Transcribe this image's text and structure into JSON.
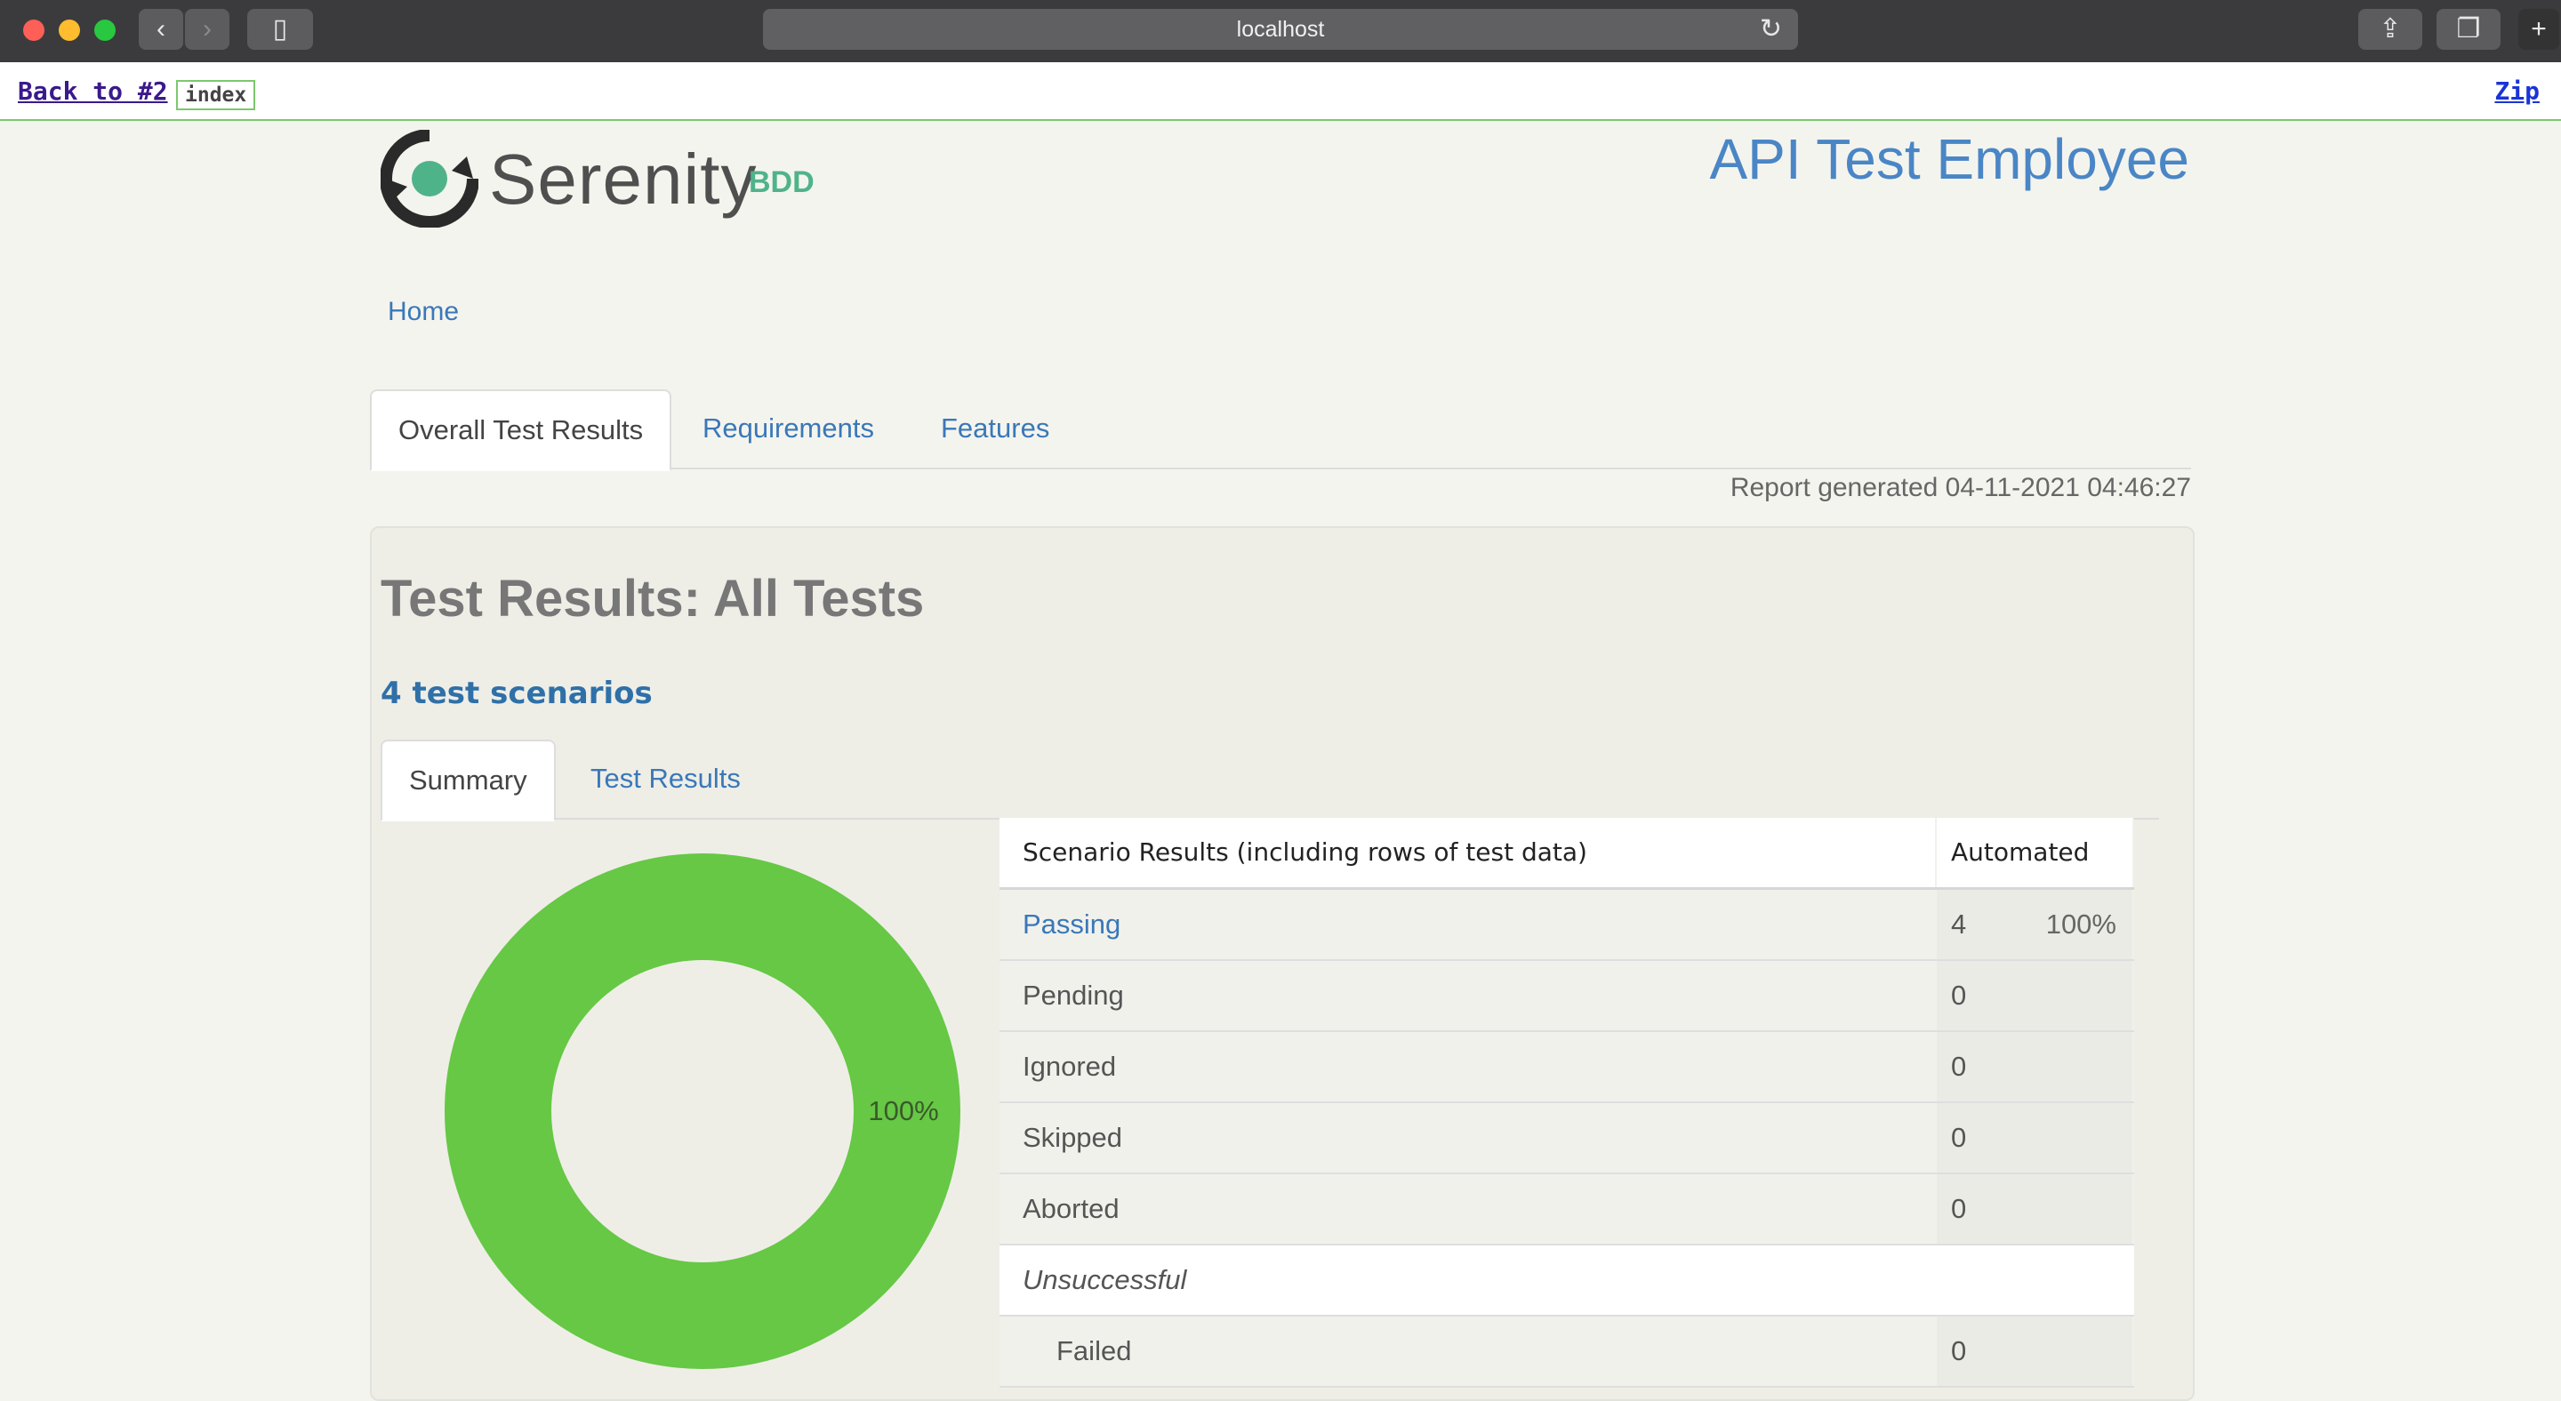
{
  "browser": {
    "url": "localhost"
  },
  "topbar": {
    "back_label": "Back to #2",
    "index_label": "index",
    "zip_label": "Zip"
  },
  "header": {
    "brand": "Serenity",
    "brand_suffix": "BDD",
    "project_title": "API Test Employee"
  },
  "nav": {
    "home": "Home",
    "tabs": [
      {
        "label": "Overall Test Results"
      },
      {
        "label": "Requirements"
      },
      {
        "label": "Features"
      }
    ],
    "report_generated": "Report generated 04-11-2021 04:46:27"
  },
  "results": {
    "title": "Test Results: All Tests",
    "scenario_count": "4 test scenarios",
    "sub_tabs": [
      {
        "label": "Summary"
      },
      {
        "label": "Test Results"
      }
    ],
    "table": {
      "header_label": "Scenario Results (including rows of test data)",
      "header_count": "Automated",
      "rows": [
        {
          "label": "Passing",
          "count": "4",
          "pct": "100%"
        },
        {
          "label": "Pending",
          "count": "0"
        },
        {
          "label": "Ignored",
          "count": "0"
        },
        {
          "label": "Skipped",
          "count": "0"
        },
        {
          "label": "Aborted",
          "count": "0"
        },
        {
          "label": "Unsuccessful"
        },
        {
          "label": "Failed",
          "count": "0"
        }
      ]
    }
  },
  "chart_data": {
    "type": "pie",
    "categories": [
      "Passing"
    ],
    "values": [
      100
    ],
    "data_label": "100%",
    "colors": [
      "#66c845"
    ]
  },
  "colors": {
    "passing": "#66c845",
    "link": "#3a78b8",
    "brand_green": "#4fb38a"
  }
}
